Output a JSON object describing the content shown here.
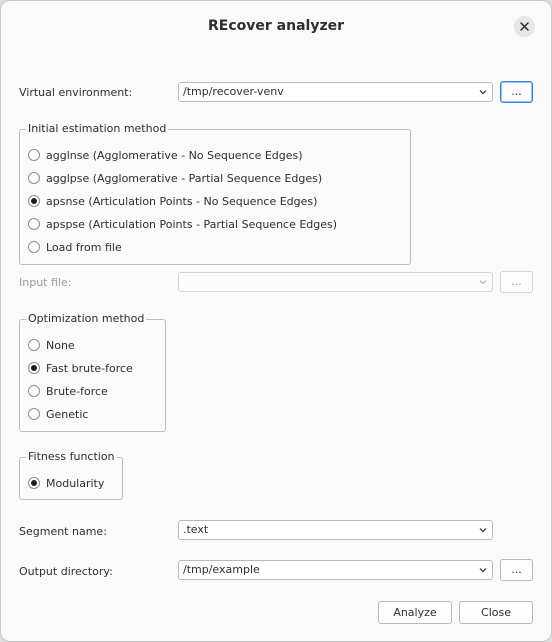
{
  "window": {
    "title": "REcover analyzer"
  },
  "venv": {
    "label": "Virtual environment:",
    "value": "/tmp/recover-venv",
    "browse": "..."
  },
  "initial": {
    "title": "Initial estimation method",
    "options": [
      {
        "label": "agglnse (Agglomerative - No Sequence Edges)",
        "checked": false
      },
      {
        "label": "agglpse (Agglomerative - Partial Sequence Edges)",
        "checked": false
      },
      {
        "label": "apsnse (Articulation Points - No Sequence Edges)",
        "checked": true
      },
      {
        "label": "apspse (Articulation Points - Partial Sequence Edges)",
        "checked": false
      },
      {
        "label": "Load from file",
        "checked": false
      }
    ]
  },
  "input_file": {
    "label": "Input file:",
    "value": "",
    "browse": "..."
  },
  "optimization": {
    "title": "Optimization method",
    "options": [
      {
        "label": "None",
        "checked": false
      },
      {
        "label": "Fast brute-force",
        "checked": true
      },
      {
        "label": "Brute-force",
        "checked": false
      },
      {
        "label": "Genetic",
        "checked": false
      }
    ]
  },
  "fitness": {
    "title": "Fitness function",
    "options": [
      {
        "label": "Modularity",
        "checked": true
      }
    ]
  },
  "segment": {
    "label": "Segment name:",
    "value": ".text"
  },
  "output": {
    "label": "Output directory:",
    "value": "/tmp/example",
    "browse": "..."
  },
  "buttons": {
    "analyze": "Analyze",
    "close": "Close"
  },
  "icons": {
    "close": "close-icon",
    "dropdown": "chevron-down-icon"
  }
}
